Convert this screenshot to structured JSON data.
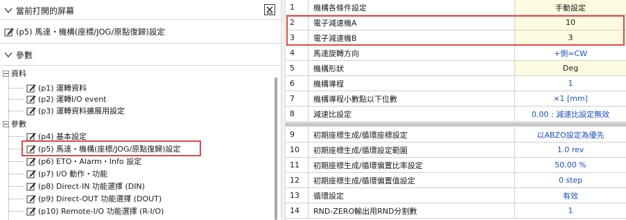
{
  "left_panel": {
    "open_screens_header": "當前打開的屏幕",
    "open_screen_item": "(p5) 馬達・機構(座標/JOG/原點復歸)設定",
    "params_header": "參數",
    "tree": {
      "group_data": "資料",
      "data_items": [
        "(p1) 運轉資料",
        "(p2) 運轉I/O event",
        "(p3) 運轉資料擴展用設定"
      ],
      "group_params": "參數",
      "param_items": [
        "(p4) 基本設定",
        "(p5) 馬達・機構(座標/JOG/原點復歸)設定",
        "(p6) ETO・Alarm・Info 設定",
        "(p7) I/O 動作・功能",
        "(p8) Direct-IN 功能選擇 (DIN)",
        "(p9) Direct-OUT 功能選擇 (DOUT)",
        "(p10) Remote-I/O 功能選擇 (R-I/O)"
      ]
    }
  },
  "grid": {
    "rows": [
      {
        "num": "1",
        "name": "機構各條件設定",
        "value": "手動設定"
      },
      {
        "num": "2",
        "name": "電子減速機A",
        "value": "10"
      },
      {
        "num": "3",
        "name": "電子減速機B",
        "value": "3"
      },
      {
        "num": "4",
        "name": "馬達旋轉方向",
        "value": "+側=CW"
      },
      {
        "num": "5",
        "name": "機構形狀",
        "value": "Deg"
      },
      {
        "num": "6",
        "name": "機構導程",
        "value": "1"
      },
      {
        "num": "7",
        "name": "機構導程小數點以下位數",
        "value": "×1 [mm]"
      },
      {
        "num": "8",
        "name": "減速比設定",
        "value": "0.00 : 減速比設定無效"
      },
      {
        "num": "9",
        "name": "初期座標生成/循環座標設定",
        "value": "以ABZO設定為優先"
      },
      {
        "num": "10",
        "name": "初期座標生成/循環設定範圍",
        "value": "1.0 rev"
      },
      {
        "num": "11",
        "name": "初期座標生成/循環偏置比率設定",
        "value": "50.00 %"
      },
      {
        "num": "12",
        "name": "初期座標生成/循環偏置值設定",
        "value": "0 step"
      },
      {
        "num": "13",
        "name": "循環設定",
        "value": "有效"
      },
      {
        "num": "14",
        "name": "RND-ZERO輸出用RND分割數",
        "value": "1"
      }
    ]
  },
  "colors": {
    "highlight_border": "#e04848",
    "value_text": "#1a4fd0",
    "editable_cell_bg": "#fdfbe0"
  }
}
